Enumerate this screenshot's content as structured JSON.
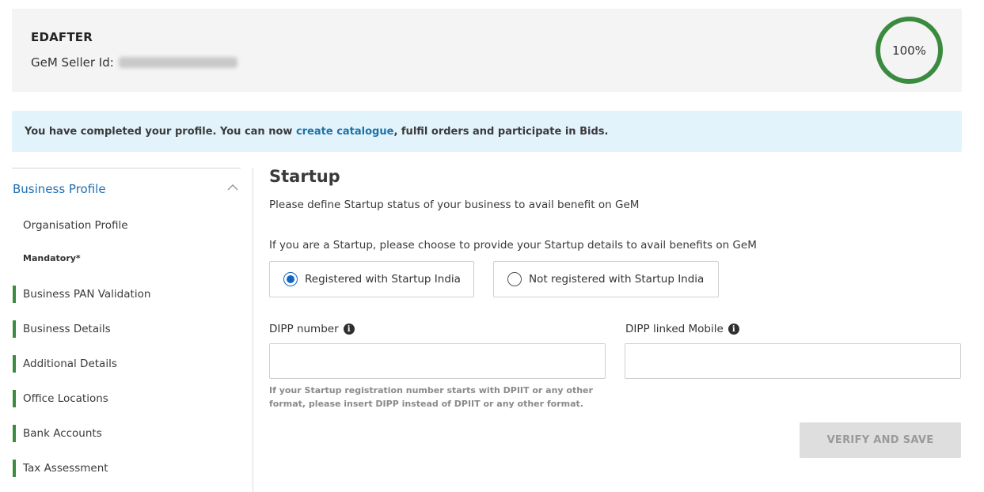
{
  "header": {
    "company_name": "EDAFTER",
    "seller_id_label": "GeM Seller Id:",
    "progress": "100%"
  },
  "banner": {
    "text_before": "You have completed your profile. You can now ",
    "link_text": "create catalogue",
    "text_after": ", fulfil orders and participate in Bids."
  },
  "sidebar": {
    "title": "Business Profile",
    "first_item": "Organisation Profile",
    "mandatory_label": "Mandatory*",
    "items": [
      {
        "label": "Business PAN Validation"
      },
      {
        "label": "Business Details"
      },
      {
        "label": "Additional Details"
      },
      {
        "label": "Office Locations"
      },
      {
        "label": "Bank Accounts"
      },
      {
        "label": "Tax Assessment"
      }
    ]
  },
  "main": {
    "title": "Startup",
    "subtitle": "Please define Startup status of your business to avail benefit on GeM",
    "prompt": "If you are a Startup, please choose to provide your Startup details to avail benefits on GeM",
    "options": [
      {
        "label": "Registered with Startup India",
        "selected": true
      },
      {
        "label": "Not registered with Startup India",
        "selected": false
      }
    ],
    "dipp_number_label": "DIPP number",
    "dipp_number_value": "",
    "dipp_mobile_label": "DIPP linked Mobile",
    "dipp_mobile_value": "",
    "hint": "If your Startup registration number starts with DPIIT or any other format, please insert DIPP instead of DPIIT or any other format.",
    "verify_button": "VERIFY AND SAVE"
  },
  "colors": {
    "accent_green": "#3a8b3f",
    "link_blue": "#1a73a8",
    "radio_blue": "#1565c0",
    "banner_bg": "#e3f3fc"
  },
  "icons": {
    "info": "info-icon",
    "collapse": "chevron-up-icon"
  }
}
